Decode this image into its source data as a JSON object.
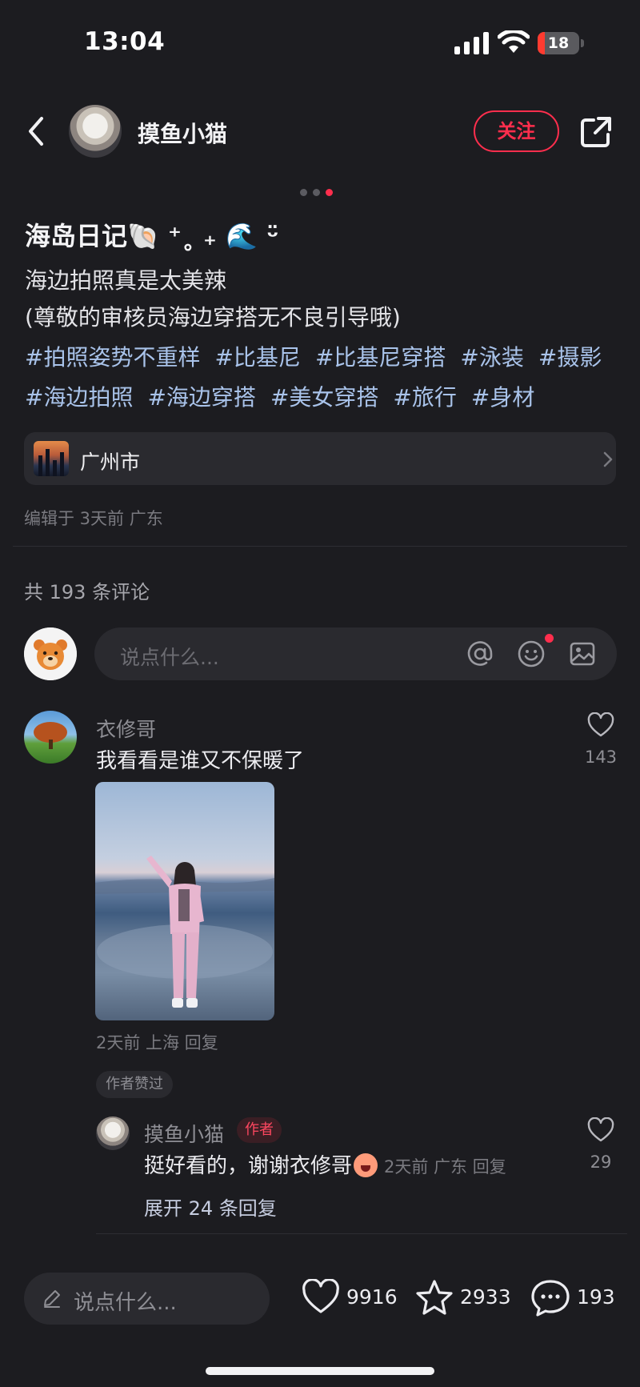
{
  "status": {
    "time": "13:04",
    "battery": "18",
    "battery_level": 0.18
  },
  "header": {
    "author": "摸鱼小猫",
    "follow_label": "关注"
  },
  "note": {
    "title": "海岛日记🐚 ⁺˳ ₊ 🌊 ᵕ̈",
    "body_lines": [
      "海边拍照真是太美辣",
      "(尊敬的审核员海边穿搭无不良引导哦)"
    ],
    "tags": [
      "#拍照姿势不重样",
      "#比基尼",
      "#比基尼穿搭",
      "#泳装",
      "#摄影",
      "#海边拍照",
      "#海边穿搭",
      "#美女穿搭",
      "#旅行",
      "#身材"
    ],
    "location": "广州市",
    "edit_meta": "编辑于 3天前 广东"
  },
  "comments": {
    "count_label": "共 193 条评论",
    "placeholder": "说点什么...",
    "items": [
      {
        "user": "衣修哥",
        "text": "我看看是谁又不保暖了",
        "likes": "143",
        "meta": "2天前 上海 回复",
        "author_liked": "作者赞过",
        "reply": {
          "user": "摸鱼小猫",
          "badge": "作者",
          "text": "挺好看的，谢谢衣修哥",
          "meta": "2天前 广东 回复",
          "likes": "29"
        },
        "expand_label": "展开 24 条回复"
      }
    ]
  },
  "bottom_bar": {
    "placeholder": "说点什么...",
    "likes": "9916",
    "favorites": "2933",
    "comments": "193"
  }
}
